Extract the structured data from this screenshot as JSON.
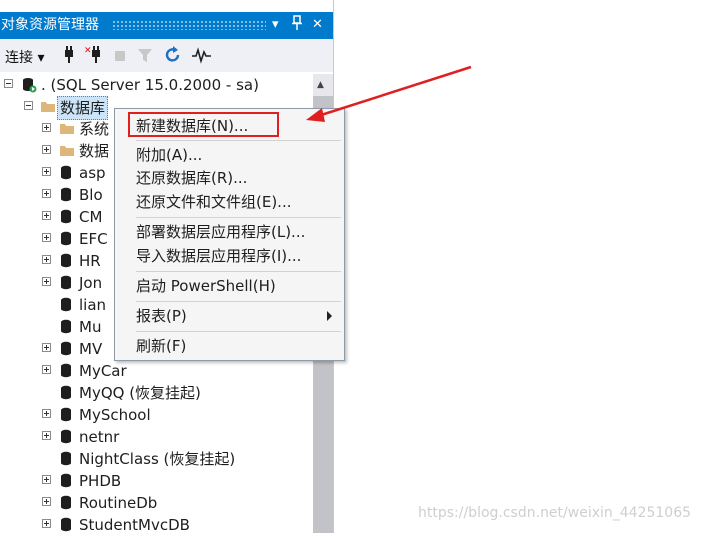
{
  "panel": {
    "title": "对象资源管理器",
    "buttons": {
      "dropdown": "▾",
      "pin": "⊥",
      "close": "✕"
    }
  },
  "toolbar": {
    "connect_label": "连接",
    "icons": [
      "connect-plug-icon",
      "disconnect-icon",
      "stop-icon",
      "filter-icon",
      "refresh-icon",
      "activity-monitor-icon"
    ]
  },
  "tree": {
    "server": ". (SQL Server 15.0.2000 - sa)",
    "databases_label": "数据库",
    "items": [
      {
        "label": "系统"
      },
      {
        "label": "数据"
      },
      {
        "label": "asp"
      },
      {
        "label": "Blo"
      },
      {
        "label": "CM"
      },
      {
        "label": "EFC"
      },
      {
        "label": "HR"
      },
      {
        "label": "Jon"
      },
      {
        "label": "lian"
      },
      {
        "label": "Mu"
      },
      {
        "label": "MV"
      },
      {
        "label": "MyCar"
      },
      {
        "label": "MyQQ (恢复挂起)"
      },
      {
        "label": "MySchool"
      },
      {
        "label": "netnr"
      },
      {
        "label": "NightClass (恢复挂起)"
      },
      {
        "label": "PHDB"
      },
      {
        "label": "RoutineDb"
      },
      {
        "label": "StudentMvcDB"
      }
    ]
  },
  "context_menu": {
    "items": [
      {
        "label": "新建数据库(N)..."
      },
      {
        "label": "附加(A)..."
      },
      {
        "label": "还原数据库(R)..."
      },
      {
        "label": "还原文件和文件组(E)..."
      },
      {
        "label": "部署数据层应用程序(L)..."
      },
      {
        "label": "导入数据层应用程序(I)..."
      },
      {
        "label": "启动 PowerShell(H)"
      },
      {
        "label": "报表(P)"
      },
      {
        "label": "刷新(F)"
      }
    ]
  },
  "annotation": {
    "color": "#e02020"
  },
  "watermark": "https://blog.csdn.net/weixin_44251065",
  "colors": {
    "accent": "#007acc",
    "selection": "#cce4f7"
  }
}
